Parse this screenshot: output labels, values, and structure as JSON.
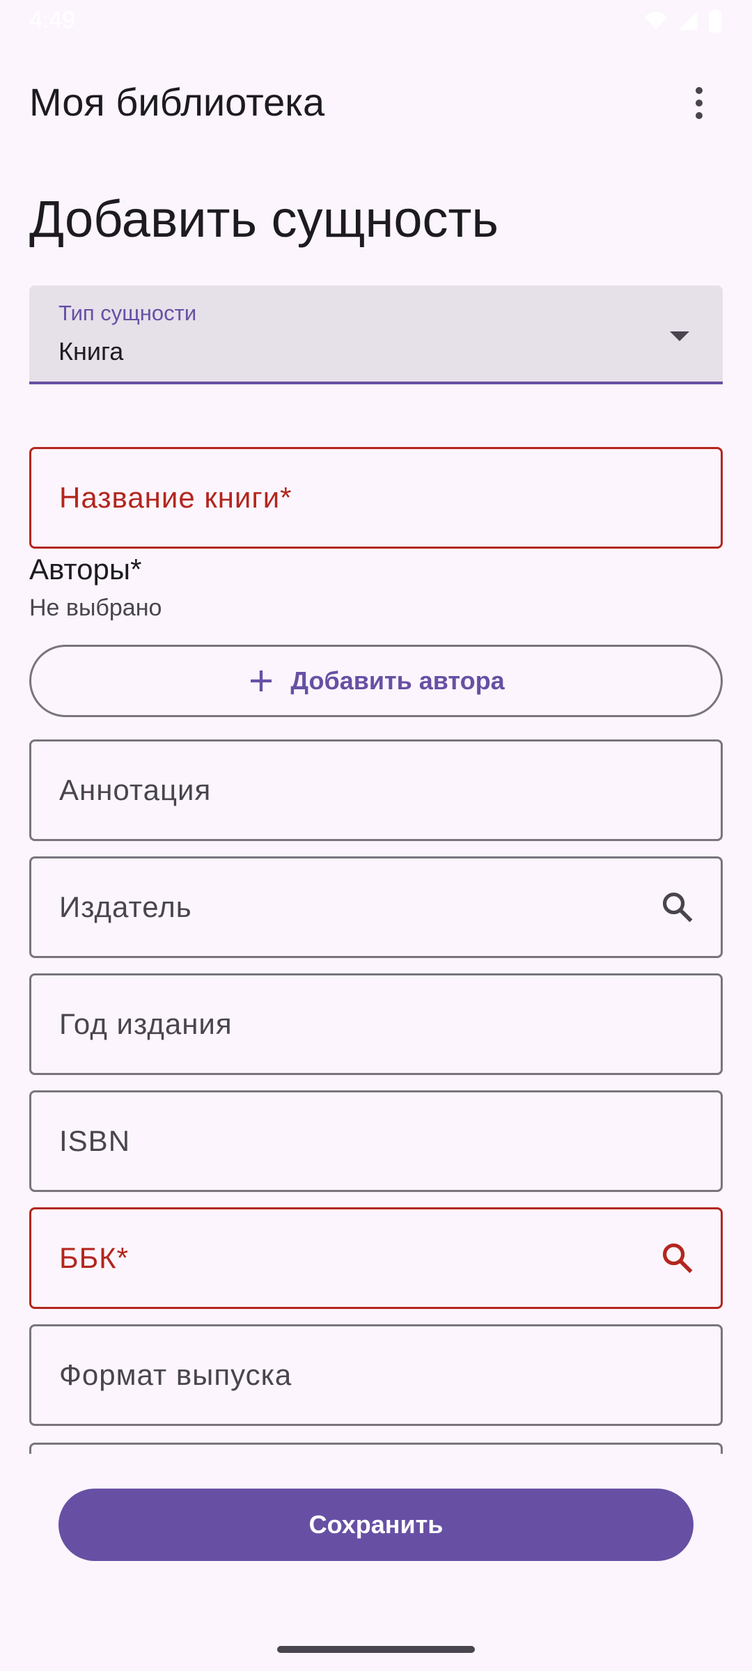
{
  "status_bar": {
    "time": "4:49",
    "icons": [
      "wifi-icon",
      "signal-icon",
      "battery-icon"
    ]
  },
  "app_bar": {
    "title": "Моя библиотека",
    "menu_icon": "more-vert-icon"
  },
  "page": {
    "heading": "Добавить сущность"
  },
  "entity_type": {
    "label": "Тип сущности",
    "value": "Книга"
  },
  "form": {
    "title_field": "Название книги*",
    "authors_label": "Авторы*",
    "authors_value": "Не выбрано",
    "add_author_label": "Добавить автора",
    "annotation_field": "Аннотация",
    "publisher_field": "Издатель",
    "year_field": "Год издания",
    "isbn_field": "ISBN",
    "bbk_field": "ББК*",
    "format_field": "Формат выпуска"
  },
  "actions": {
    "save_label": "Сохранить"
  },
  "colors": {
    "primary": "#6750a4",
    "error": "#b3261e",
    "background": "#fcf5fd",
    "outline": "#79747e"
  }
}
